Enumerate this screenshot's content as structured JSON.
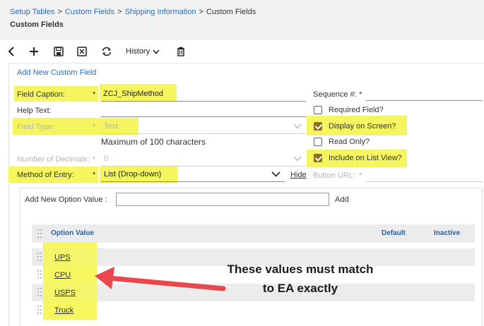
{
  "breadcrumb": {
    "items": [
      "Setup Tables",
      "Custom Fields",
      "Shipping Information"
    ],
    "separator": ">",
    "current": "Custom Fields"
  },
  "page_title": "Custom Fields",
  "toolbar": {
    "back_icon": "chevron-left-icon",
    "add_icon": "plus-icon",
    "save_icon": "save-icon",
    "save_close_icon": "save-close-icon",
    "refresh_icon": "refresh-icon",
    "history_label": "History",
    "delete_icon": "trash-icon"
  },
  "form": {
    "section_title": "Add New Custom Field",
    "field_caption": {
      "label": "Field Caption:",
      "required": "*",
      "value": "ZCJ_ShipMethod"
    },
    "help_text": {
      "label": "Help Text:",
      "value": ""
    },
    "field_type": {
      "label": "Field Type:",
      "required": "*",
      "value": "Text",
      "disabled": true
    },
    "max_note": "Maximum of 100 characters",
    "number_of_decimals": {
      "label": "Number of Decimals:",
      "required": "*",
      "value": "0",
      "disabled": true
    },
    "method_of_entry": {
      "label": "Method of Entry:",
      "required": "*",
      "value": "List (Drop-down)"
    },
    "hide_link": "Hide",
    "sequence": {
      "label": "Sequence #:",
      "required": "*",
      "value": ""
    },
    "button_url": {
      "label": "Button URL:",
      "required": "*",
      "value": ""
    },
    "checkboxes": [
      {
        "label": "Required Field?",
        "checked": false
      },
      {
        "label": "Display on Screen?",
        "checked": true
      },
      {
        "label": "Read Only?",
        "checked": false
      },
      {
        "label": "Include on List View?",
        "checked": true
      }
    ]
  },
  "options": {
    "add_label": "Add New Option Value :",
    "add_input_value": "",
    "add_button": "Add",
    "columns": [
      "Option Value",
      "Default",
      "Inactive"
    ],
    "rows": [
      "UPS",
      "CPU",
      "USPS",
      "Truck"
    ]
  },
  "annotation": {
    "line1": "These values must match",
    "line2": "to EA exactly"
  },
  "colors": {
    "highlight": "#f5f560",
    "arrow": "#e8474c",
    "link": "#2a6ebb",
    "checkbox_checked": "#8a6d1d"
  }
}
